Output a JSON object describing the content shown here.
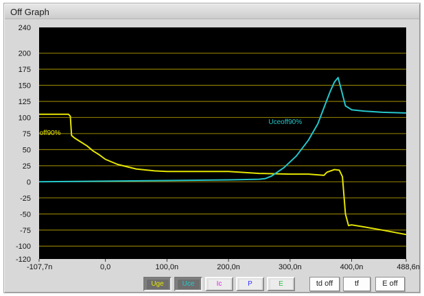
{
  "window": {
    "title": "Off Graph"
  },
  "chart_data": {
    "type": "line",
    "xlim": [
      -107.7,
      488.6
    ],
    "ylim": [
      -120,
      240
    ],
    "y_ticks": [
      "240",
      "200",
      "175",
      "150",
      "125",
      "100",
      "75",
      "50",
      "25",
      "0",
      "-25",
      "-50",
      "-75",
      "-100",
      "-120"
    ],
    "x_ticks": [
      "-107,7n",
      "0,0",
      "100,0n",
      "200,0n",
      "300,0n",
      "400,0n",
      "488,6n"
    ],
    "grid": true,
    "background": "#000000",
    "grid_color": "#8a7a00",
    "series": [
      {
        "name": "Uge",
        "color": "#e6e600",
        "x": [
          -107.7,
          -60,
          -57,
          -55,
          -50,
          -40,
          -30,
          -20,
          -10,
          0,
          20,
          50,
          80,
          100,
          150,
          200,
          250,
          300,
          330,
          355,
          360,
          372,
          380,
          385,
          390,
          395,
          400,
          420,
          450,
          488.6
        ],
        "y": [
          105,
          105,
          102,
          72,
          68,
          62,
          56,
          48,
          42,
          35,
          27,
          20,
          17,
          16,
          16,
          16,
          13,
          12,
          12,
          10,
          15,
          19,
          18,
          8,
          -50,
          -68,
          -67,
          -70,
          -75,
          -82
        ]
      },
      {
        "name": "Uce",
        "color": "#25c8cc",
        "x": [
          -107.7,
          0,
          100,
          200,
          250,
          260,
          270,
          290,
          310,
          330,
          345,
          355,
          365,
          372,
          378,
          384,
          390,
          400,
          420,
          450,
          488.6
        ],
        "y": [
          0,
          1,
          2,
          3,
          4,
          5,
          9,
          22,
          40,
          65,
          90,
          115,
          140,
          155,
          162,
          140,
          118,
          112,
          110,
          108,
          107
        ]
      }
    ],
    "annotations": [
      {
        "text": "Uceoff90%",
        "color": "#25c8cc",
        "x": 265,
        "y": 90
      },
      {
        "text": "off90%",
        "color": "#e6e600",
        "x": -107,
        "y": 73
      }
    ]
  },
  "series_buttons": [
    {
      "label": "Uge",
      "color": "#e6e600",
      "pressed": true
    },
    {
      "label": "Uce",
      "color": "#25c8cc",
      "pressed": true
    },
    {
      "label": "Ic",
      "color": "#e020e0",
      "pressed": false
    },
    {
      "label": "P",
      "color": "#3030ff",
      "pressed": false
    },
    {
      "label": "E",
      "color": "#20c040",
      "pressed": false
    }
  ],
  "action_buttons": [
    {
      "label": "td off"
    },
    {
      "label": "tf"
    },
    {
      "label": "E off"
    }
  ]
}
